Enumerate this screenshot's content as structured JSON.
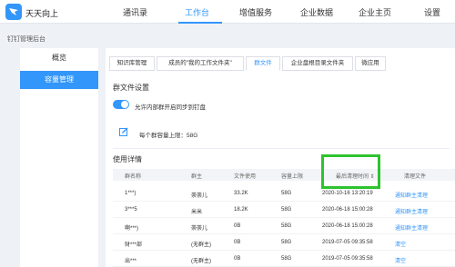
{
  "app": {
    "brand": "天天向上"
  },
  "nav": {
    "items": [
      {
        "label": "通讯录"
      },
      {
        "label": "工作台"
      },
      {
        "label": "增值服务"
      },
      {
        "label": "企业数据"
      },
      {
        "label": "企业主页"
      },
      {
        "label": "设置"
      }
    ],
    "active_index": 1
  },
  "page": {
    "subtitle": "钉钉管理后台"
  },
  "left_menu": {
    "items": [
      {
        "label": "概览"
      },
      {
        "label": "容量管理"
      }
    ],
    "active_index": 1
  },
  "tabs": [
    {
      "label": "知识库管理"
    },
    {
      "label": "成员的\"我的工作文件夹\""
    },
    {
      "label": "群文件"
    },
    {
      "label": "企业盘根目录文件夹"
    },
    {
      "label": "微应用"
    }
  ],
  "active_tab": 2,
  "group_settings": {
    "title": "群文件设置",
    "sync_label": "允许内部群开启同步到钉盘",
    "sync_enabled": true,
    "quota_label": "每个群容量上限：58G"
  },
  "usage": {
    "title": "使用详情",
    "columns": {
      "name": "群名称",
      "owner": "群主",
      "used": "文件使用",
      "limit": "容量上限",
      "last_cleared": "最后清理时间 ⇕",
      "action": "清理文件"
    },
    "rows": [
      {
        "name": "1***)",
        "owner": "荼荼儿",
        "used": "33.2K",
        "limit": "58G",
        "time": "2020-10-16 13:20:19",
        "action_a": "通知群主清理",
        "action_b": ""
      },
      {
        "name": "3***5",
        "owner": "米米",
        "used": "18.2K",
        "limit": "58G",
        "time": "2020-06-18 15:00:28",
        "action_a": "通知群主清理",
        "action_b": ""
      },
      {
        "name": "啊***)",
        "owner": "荼荼儿",
        "used": "0B",
        "limit": "58G",
        "time": "2020-06-18 15:00:28",
        "action_a": "通知群主清理",
        "action_b": ""
      },
      {
        "name": "财***部",
        "owner": "(无群主)",
        "used": "0B",
        "limit": "58G",
        "time": "2019-07-05 09:35:58",
        "action_a": "清空",
        "action_b": ""
      },
      {
        "name": "出***",
        "owner": "(无群主)",
        "used": "0B",
        "limit": "58G",
        "time": "2019-07-05 09:35:58",
        "action_a": "清空",
        "action_b": ""
      }
    ]
  },
  "colors": {
    "accent": "#3296fa",
    "highlight": "#2ec32e"
  }
}
